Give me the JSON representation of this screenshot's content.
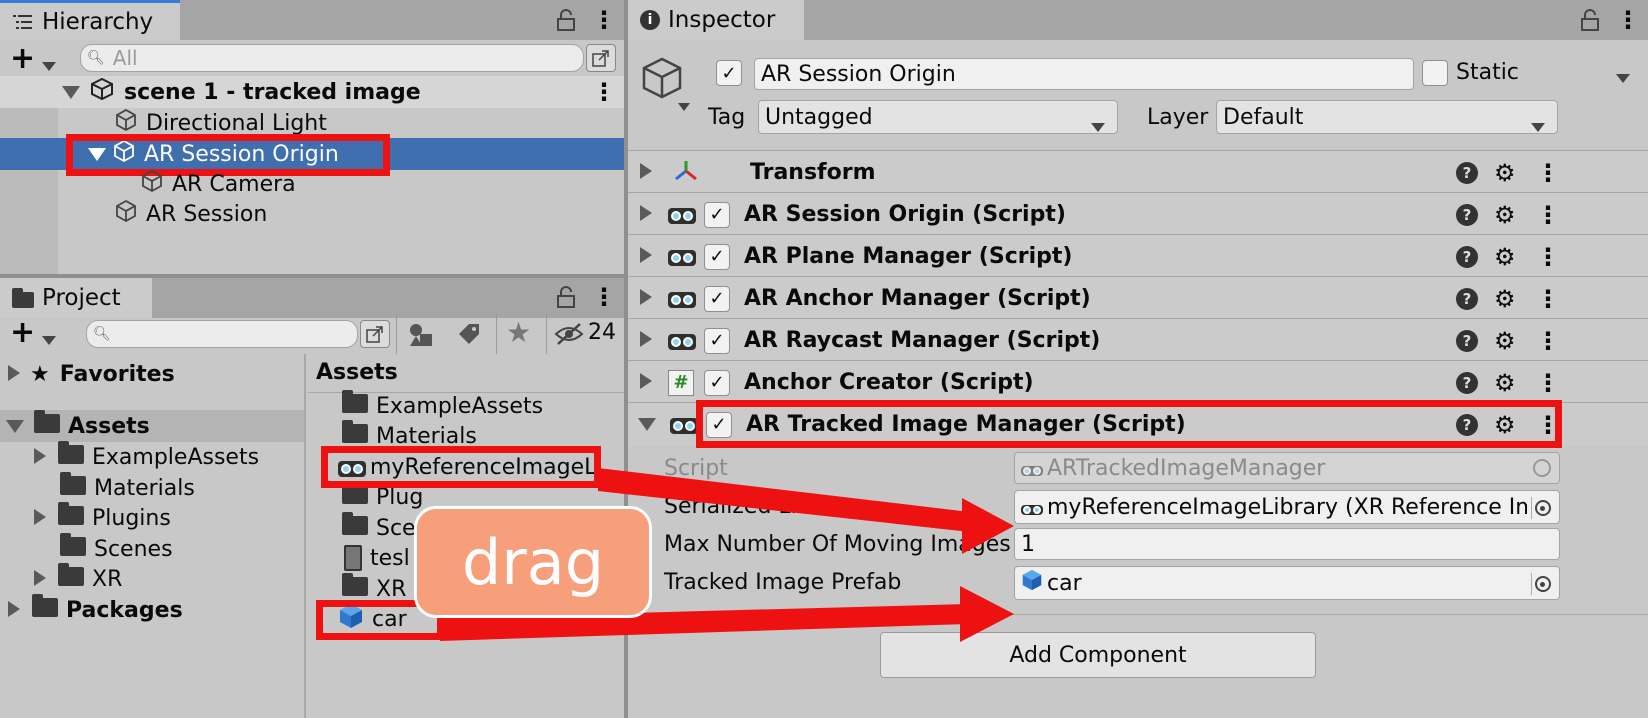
{
  "hierarchy": {
    "tab_label": "Hierarchy",
    "search_placeholder": "All",
    "scene_name": "scene 1 - tracked image",
    "items": [
      {
        "label": "Directional Light"
      },
      {
        "label": "AR Session Origin"
      },
      {
        "label": "AR Camera"
      },
      {
        "label": "AR Session"
      }
    ]
  },
  "project": {
    "tab_label": "Project",
    "hidden_count": "24",
    "tree": {
      "favorites": "Favorites",
      "assets": "Assets",
      "children": [
        "ExampleAssets",
        "Materials",
        "Plugins",
        "Scenes",
        "XR"
      ],
      "packages": "Packages"
    },
    "assets_header": "Assets",
    "files": [
      "ExampleAssets",
      "Materials",
      "myReferenceImageL",
      "Plug",
      "Sce",
      "tesl",
      "XR",
      "car"
    ]
  },
  "overlay": {
    "drag_label": "drag"
  },
  "inspector": {
    "tab_label": "Inspector",
    "object_name": "AR Session Origin",
    "static_label": "Static",
    "tag_label": "Tag",
    "tag_value": "Untagged",
    "layer_label": "Layer",
    "layer_value": "Default",
    "components": [
      {
        "name": "Transform"
      },
      {
        "name": "AR Session Origin (Script)"
      },
      {
        "name": "AR Plane Manager (Script)"
      },
      {
        "name": "AR Anchor Manager (Script)"
      },
      {
        "name": "AR Raycast Manager (Script)"
      },
      {
        "name": "Anchor Creator (Script)"
      },
      {
        "name": "AR Tracked Image Manager (Script)"
      }
    ],
    "fields": {
      "script_label": "Script",
      "script_value": "ARTrackedImageManager",
      "library_label": "Serialized Library",
      "library_value": "myReferenceImageLibrary (XR Reference Ima",
      "moving_label": "Max Number Of Moving Images",
      "moving_value": "1",
      "prefab_label": "Tracked Image Prefab",
      "prefab_value": "car"
    },
    "add_component": "Add Component"
  },
  "colors": {
    "highlight_red": "#ee1111",
    "selection_blue": "#3f6fae",
    "drag_badge": "#f79e7a"
  }
}
